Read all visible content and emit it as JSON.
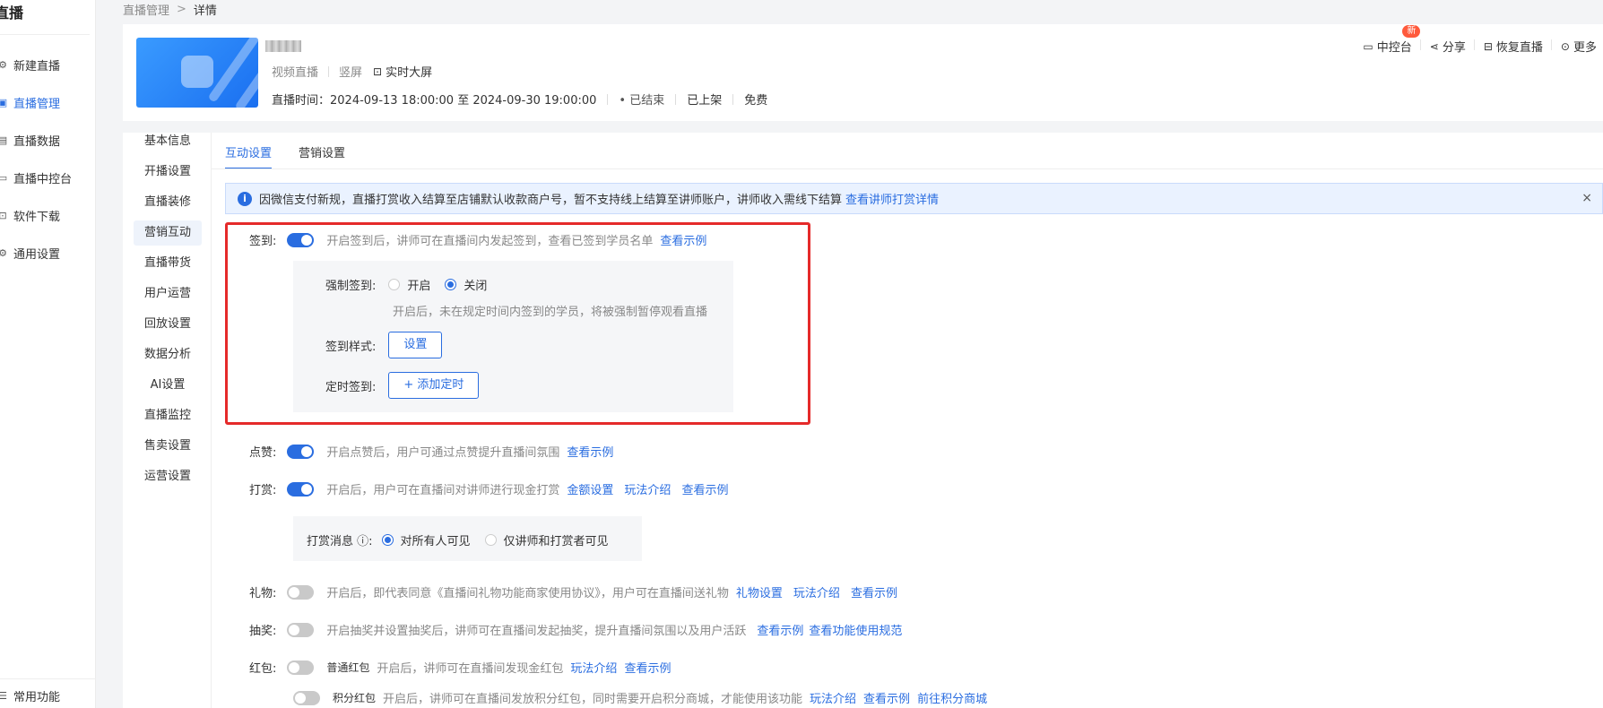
{
  "sidebar": {
    "brand": "直播",
    "items": [
      {
        "label": "新建直播",
        "icon": "gear-icon",
        "glyph": "⚙",
        "active": false
      },
      {
        "label": "直播管理",
        "icon": "box-icon",
        "glyph": "▣",
        "active": true
      },
      {
        "label": "直播数据",
        "icon": "chart-icon",
        "glyph": "▤",
        "active": false
      },
      {
        "label": "直播中控台",
        "icon": "monitor-icon",
        "glyph": "▭",
        "active": false
      },
      {
        "label": "软件下载",
        "icon": "download-icon",
        "glyph": "⊡",
        "active": false
      },
      {
        "label": "通用设置",
        "icon": "settings-icon",
        "glyph": "⚙",
        "active": false
      }
    ],
    "bottom_label": "常用功能"
  },
  "breadcrumb": {
    "parent": "直播管理",
    "sep": ">",
    "current": "详情"
  },
  "header": {
    "meta_type": "视频直播",
    "meta_orientation": "竖屏",
    "meta_screen": "实时大屏",
    "time_label": "直播时间：2024-09-13 18:00:00 至 2024-09-30 19:00:00",
    "status": "• 已结束",
    "listing": "已上架",
    "price": "免费",
    "actions": {
      "control": "中控台",
      "badge": "新",
      "share": "分享",
      "restore": "恢复直播",
      "more": "更多"
    }
  },
  "subnav": [
    "基本信息",
    "开播设置",
    "直播装修",
    "营销互动",
    "直播带货",
    "用户运营",
    "回放设置",
    "数据分析",
    "AI设置",
    "直播监控",
    "售卖设置",
    "运营设置"
  ],
  "tabs": {
    "interaction": "互动设置",
    "marketing": "营销设置"
  },
  "notice": {
    "text": "因微信支付新规，直播打赏收入结算至店铺默认收款商户号，暂不支持线上结算至讲师账户，讲师收入需线下结算",
    "link": "查看讲师打赏详情",
    "close": "×"
  },
  "checkin": {
    "label": "签到:",
    "enabled": true,
    "desc": "开启签到后，讲师可在直播间内发起签到，查看已签到学员名单",
    "link": "查看示例",
    "force_label": "强制签到:",
    "force_on": "开启",
    "force_off": "关闭",
    "force_desc": "开启后，未在规定时间内签到的学员，将被强制暂停观看直播",
    "style_label": "签到样式:",
    "style_btn": "设置",
    "timed_label": "定时签到:",
    "timed_btn": "+ 添加定时"
  },
  "like": {
    "label": "点赞:",
    "enabled": true,
    "desc": "开启点赞后，用户可通过点赞提升直播间氛围",
    "link": "查看示例"
  },
  "reward": {
    "label": "打赏:",
    "enabled": true,
    "desc": "开启后，用户可在直播间对讲师进行现金打赏",
    "link1": "金额设置",
    "link2": "玩法介绍",
    "link3": "查看示例",
    "msg_label": "打赏消息 ⓘ:",
    "msg_opt1": "对所有人可见",
    "msg_opt2": "仅讲师和打赏者可见"
  },
  "gift": {
    "label": "礼物:",
    "enabled": false,
    "desc": "开启后，即代表同意《直播间礼物功能商家使用协议》，用户可在直播间送礼物",
    "link1": "礼物设置",
    "link2": "玩法介绍",
    "link3": "查看示例"
  },
  "lottery": {
    "label": "抽奖:",
    "enabled": false,
    "desc": "开启抽奖并设置抽奖后，讲师可在直播间发起抽奖，提升直播间氛围以及用户活跃",
    "link1": "查看示例",
    "link2": "查看功能使用规范"
  },
  "redpacket": {
    "label": "红包:",
    "normal_enabled": false,
    "normal_name": "普通红包",
    "normal_desc": "开启后，讲师可在直播间发现金红包",
    "normal_link1": "玩法介绍",
    "normal_link2": "查看示例",
    "points_enabled": false,
    "points_name": "积分红包",
    "points_desc": "开启后，讲师可在直播间发放积分红包，同时需要开启积分商城，才能使用该功能",
    "points_link1": "玩法介绍",
    "points_link2": "查看示例",
    "points_link3": "前往积分商城"
  },
  "colors": {
    "accent": "#2a6de0",
    "highlight_box": "#e52a2a",
    "badge": "#ff5a3c"
  }
}
